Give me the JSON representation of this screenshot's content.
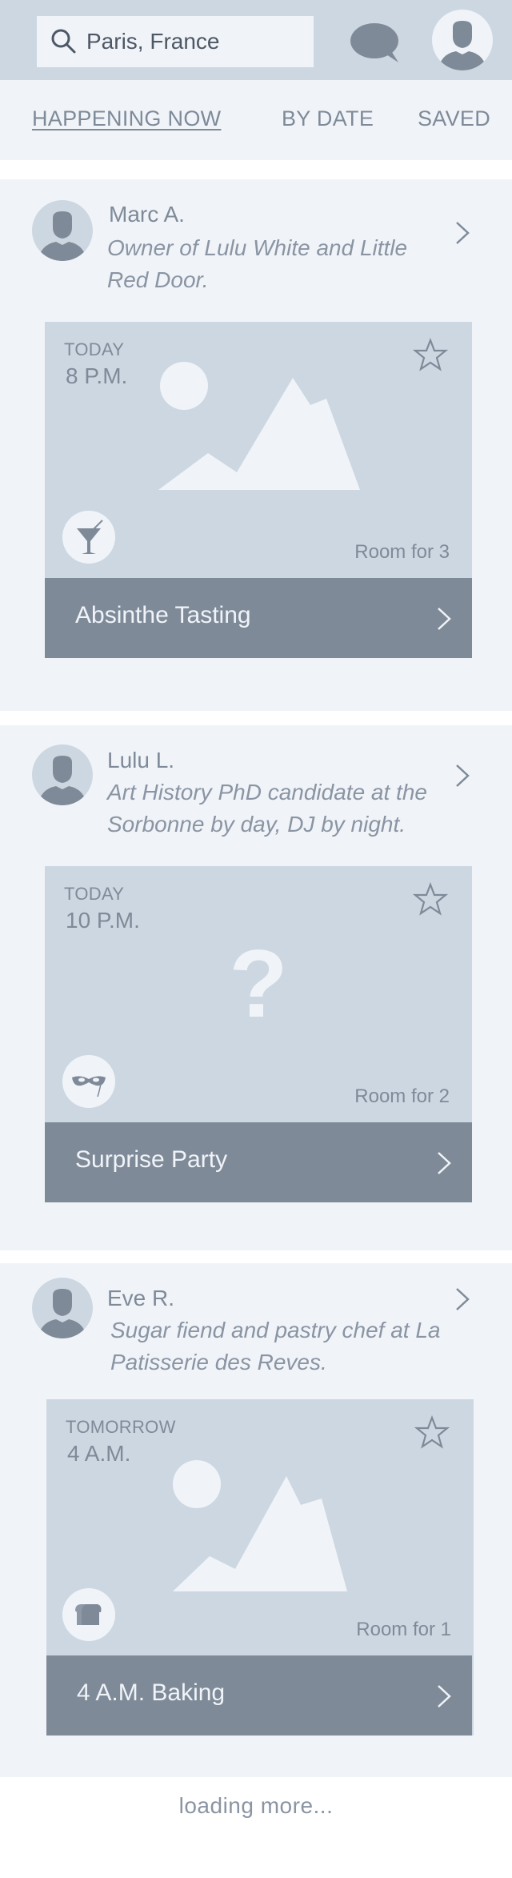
{
  "colors": {
    "header_bg": "#cdd7e2",
    "panel_bg": "#f0f4f8",
    "text": "#7f8a99",
    "bar_bg": "#7f8a99"
  },
  "search": {
    "value": "Paris, France",
    "icon": "search-icon"
  },
  "header": {
    "chat_icon": "chat-bubble-icon",
    "profile_icon": "user-avatar-icon"
  },
  "tabs": [
    {
      "label": "HAPPENING NOW",
      "active": true
    },
    {
      "label": "BY DATE",
      "active": false
    },
    {
      "label": "SAVED",
      "active": false
    }
  ],
  "events": [
    {
      "host": {
        "name": "Marc A.",
        "bio": "Owner of Lulu White and Little Red Door."
      },
      "when": "TODAY",
      "time": "8 P.M.",
      "room": "Room for 3",
      "title": "Absinthe Tasting",
      "category_icon": "cocktail-icon",
      "image": "landscape-placeholder"
    },
    {
      "host": {
        "name": "Lulu L.",
        "bio": "Art History PhD candidate at the Sorbonne by day, DJ by night."
      },
      "when": "TODAY",
      "time": "10 P.M.",
      "room": "Room for 2",
      "title": "Surprise Party",
      "category_icon": "mask-icon",
      "image": "question-mark",
      "image_text": "?"
    },
    {
      "host": {
        "name": "Eve R.",
        "bio": "Sugar fiend and pastry chef at La Patisserie des Reves."
      },
      "when": "TOMORROW",
      "time": "4 A.M.",
      "room": "Room for 1",
      "title": "4 A.M. Baking",
      "category_icon": "bread-icon",
      "image": "landscape-placeholder"
    }
  ],
  "footer": {
    "loading": "loading more..."
  }
}
